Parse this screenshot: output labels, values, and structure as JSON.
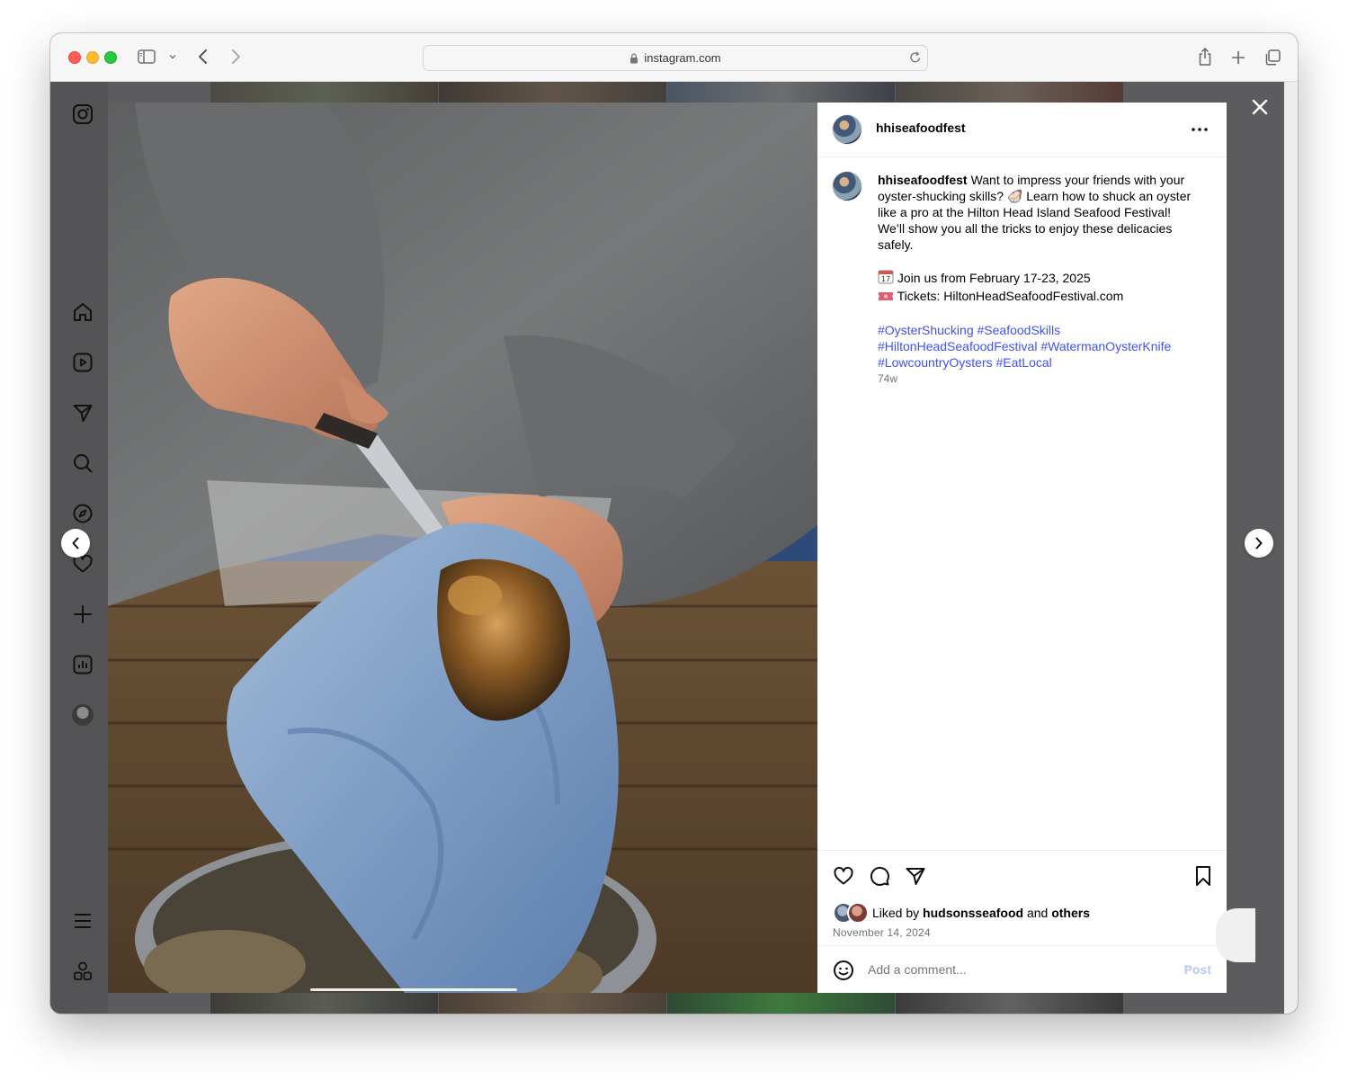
{
  "browser": {
    "url": "instagram.com"
  },
  "post": {
    "username": "hhiseafoodfest",
    "caption_lines": [
      "Want to impress your friends with your oyster-shucking skills? 🦪 Learn how to shuck an oyster like a pro at the Hilton Head Island Seafood Festival! We’ll show you all the tricks to enjoy these delicacies safely."
    ],
    "event_line": "Join us from February 17-23, 2025",
    "tickets_line": "Tickets: HiltonHeadSeafoodFestival.com",
    "hashtags": {
      "t1": "#OysterShucking",
      "t2": "#SeafoodSkills",
      "t3": "#HiltonHeadSeafoodFestival",
      "t4": "#WatermanOysterKnife",
      "t5": "#LowcountryOysters",
      "t6": "#EatLocal"
    },
    "time_ago": "74w",
    "liked_prefix": "Liked by",
    "liked_user": "hudsonsseafood",
    "liked_and": "and",
    "liked_others": "others",
    "date": "November 14, 2024",
    "comment_placeholder": "Add a comment...",
    "post_button": "Post"
  },
  "colors": {
    "link": "#4150f7",
    "post_disabled": "#b3c8f8"
  }
}
